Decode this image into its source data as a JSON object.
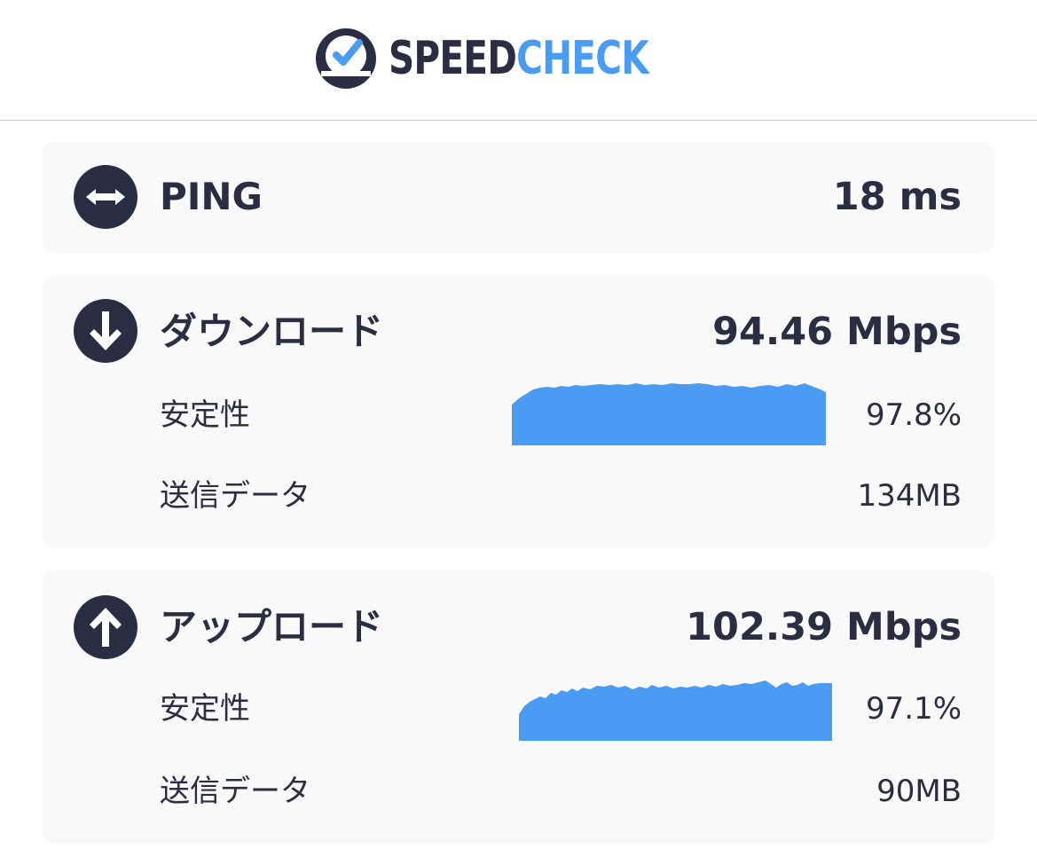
{
  "brand": {
    "part1": "SPEED",
    "part2": "CHECK",
    "accent_color": "#4a9cf2",
    "dark_color": "#2b2d42"
  },
  "ping": {
    "icon": "double-arrow-icon",
    "label": "PING",
    "value": "18 ms"
  },
  "download": {
    "icon": "arrow-down-icon",
    "label": "ダウンロード",
    "value": "94.46 Mbps",
    "stability_label": "安定性",
    "stability_value": "97.8%",
    "stability": 0.978,
    "data_label": "送信データ",
    "data_value": "134MB"
  },
  "upload": {
    "icon": "arrow-up-icon",
    "label": "アップロード",
    "value": "102.39 Mbps",
    "stability_label": "安定性",
    "stability_value": "97.1%",
    "stability": 0.971,
    "data_label": "送信データ",
    "data_value": "90MB"
  }
}
